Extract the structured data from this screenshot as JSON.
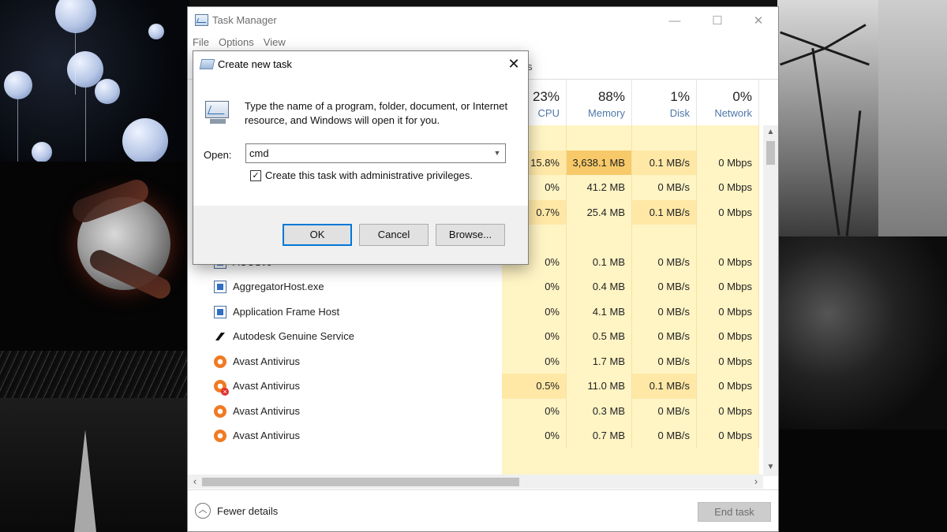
{
  "task_manager": {
    "title": "Task Manager",
    "menu": [
      "File",
      "Options",
      "View"
    ],
    "tab_fragment": "s",
    "window_controls": {
      "minimize": "—",
      "maximize": "☐",
      "close": "✕"
    },
    "columns": [
      {
        "pct": "23%",
        "label": "CPU"
      },
      {
        "pct": "88%",
        "label": "Memory"
      },
      {
        "pct": "1%",
        "label": "Disk"
      },
      {
        "pct": "0%",
        "label": "Network"
      }
    ],
    "rows": [
      {
        "name": "",
        "cpu": "",
        "mem": "",
        "disk": "",
        "net": ""
      },
      {
        "name": "",
        "cpu": "15.8%",
        "mem": "3,638.1 MB",
        "disk": "0.1 MB/s",
        "net": "0 Mbps"
      },
      {
        "name": "",
        "cpu": "0%",
        "mem": "41.2 MB",
        "disk": "0 MB/s",
        "net": "0 Mbps"
      },
      {
        "name": "",
        "cpu": "0.7%",
        "mem": "25.4 MB",
        "disk": "0.1 MB/s",
        "net": "0 Mbps"
      },
      {
        "name": "",
        "cpu": "",
        "mem": "",
        "disk": "",
        "net": ""
      },
      {
        "name": "ACCSvc",
        "cpu": "0%",
        "mem": "0.1 MB",
        "disk": "0 MB/s",
        "net": "0 Mbps",
        "icon": "service-icon",
        "expandable": true
      },
      {
        "name": "AggregatorHost.exe",
        "cpu": "0%",
        "mem": "0.4 MB",
        "disk": "0 MB/s",
        "net": "0 Mbps",
        "icon": "service-icon"
      },
      {
        "name": "Application Frame Host",
        "cpu": "0%",
        "mem": "4.1 MB",
        "disk": "0 MB/s",
        "net": "0 Mbps",
        "icon": "service-icon"
      },
      {
        "name": "Autodesk Genuine Service",
        "cpu": "0%",
        "mem": "0.5 MB",
        "disk": "0 MB/s",
        "net": "0 Mbps",
        "icon": "autodesk-icon"
      },
      {
        "name": "Avast Antivirus",
        "cpu": "0%",
        "mem": "1.7 MB",
        "disk": "0 MB/s",
        "net": "0 Mbps",
        "icon": "avast-icon"
      },
      {
        "name": "Avast Antivirus",
        "cpu": "0.5%",
        "mem": "11.0 MB",
        "disk": "0.1 MB/s",
        "net": "0 Mbps",
        "icon": "avast-alert-icon"
      },
      {
        "name": "Avast Antivirus",
        "cpu": "0%",
        "mem": "0.3 MB",
        "disk": "0 MB/s",
        "net": "0 Mbps",
        "icon": "avast-icon"
      },
      {
        "name": "Avast Antivirus",
        "cpu": "0%",
        "mem": "0.7 MB",
        "disk": "0 MB/s",
        "net": "0 Mbps",
        "icon": "avast-icon"
      }
    ],
    "highlight_colors": {
      "cells": "#fff4c4",
      "mem_high": "#f7c969",
      "cpu_med": "#ffe8a6"
    },
    "footer": {
      "fewer_details": "Fewer details",
      "end_task": "End task"
    }
  },
  "dialog": {
    "title": "Create new task",
    "close": "✕",
    "description": "Type the name of a program, folder, document, or Internet resource, and Windows will open it for you.",
    "open_label": "Open:",
    "open_value": "cmd",
    "admin_checkbox_label": "Create this task with administrative privileges.",
    "admin_checked": true,
    "buttons": {
      "ok": "OK",
      "cancel": "Cancel",
      "browse": "Browse..."
    }
  }
}
